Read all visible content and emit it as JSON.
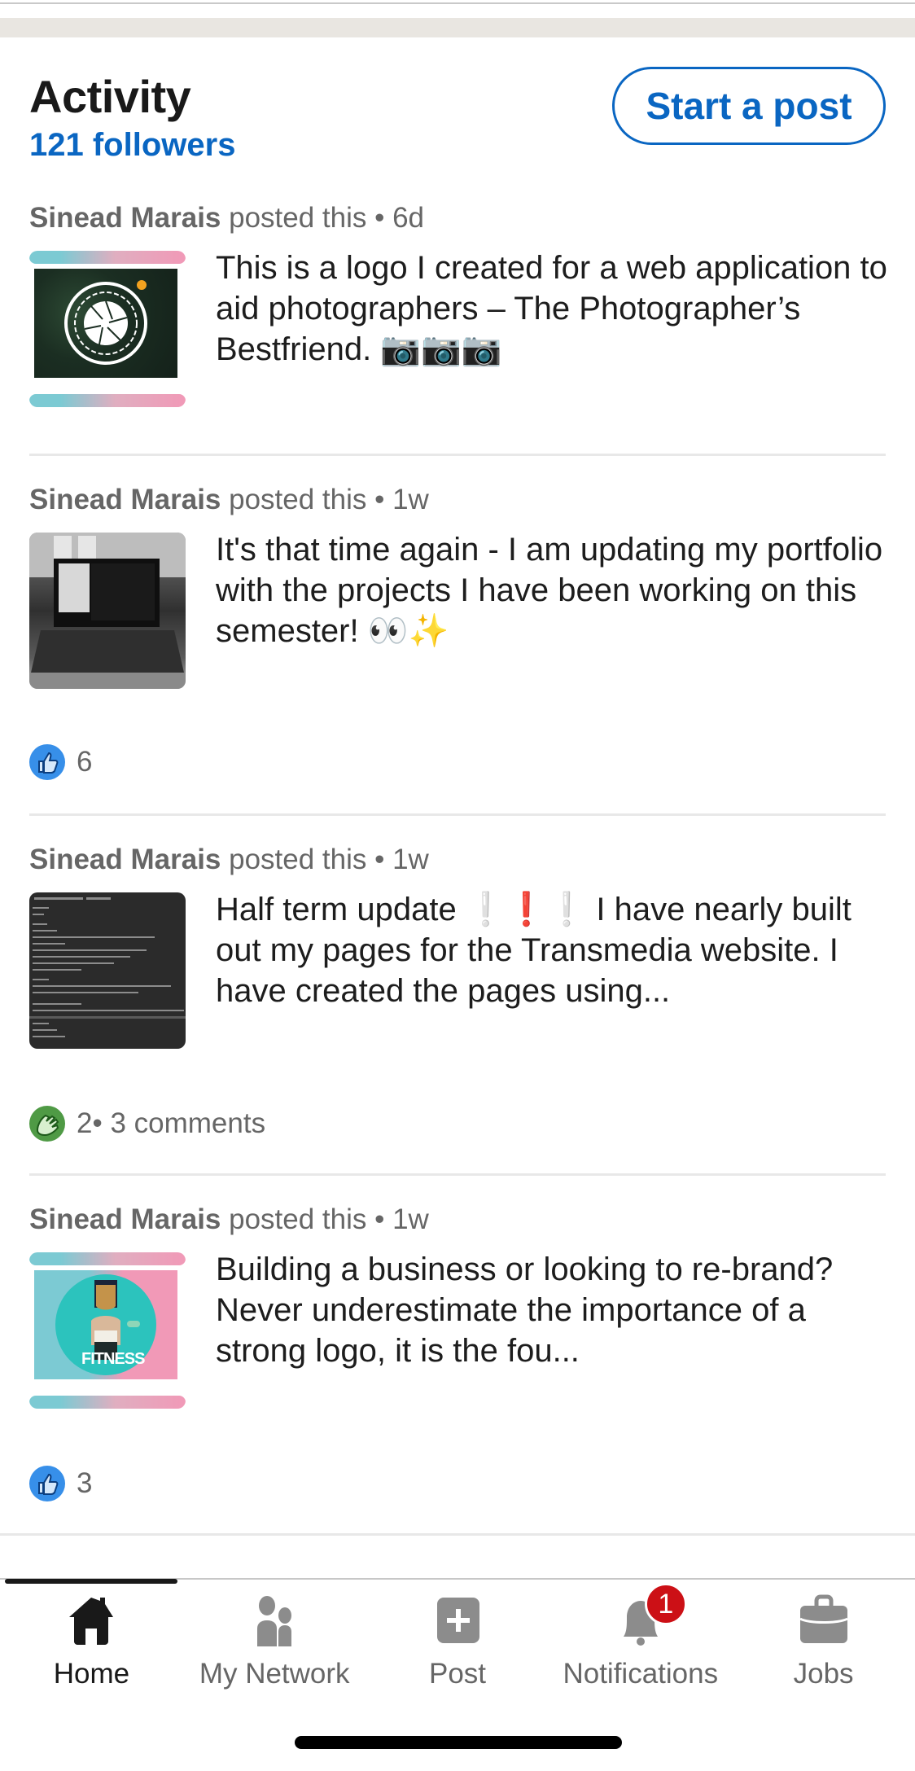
{
  "activity": {
    "title": "Activity",
    "followers": "121 followers",
    "start_post_label": "Start a post"
  },
  "posts": [
    {
      "author": "Sinead Marais",
      "action": " posted this",
      "separator": " • ",
      "age": "6d",
      "text": "This is a logo I created for a web application to aid photographers – The Photographer’s Bestfriend. 📷📷📷",
      "thumbnail": "photographer-logo-thumbnail",
      "reactions": null
    },
    {
      "author": "Sinead Marais",
      "action": " posted this",
      "separator": " • ",
      "age": "1w",
      "text": "It's that time again - I am updating my portfolio with the projects I have been working on this semester! 👀✨",
      "thumbnail": "laptop-photo-thumbnail",
      "reactions": {
        "icon": "like-icon",
        "count": "6",
        "comments": ""
      }
    },
    {
      "author": "Sinead Marais",
      "action": " posted this",
      "separator": " • ",
      "age": "1w",
      "text": "Half term update ❕❗❕ I have nearly built out my pages for the Transmedia website. I have created the pages using...",
      "thumbnail": "code-editor-thumbnail",
      "reactions": {
        "icon": "celebrate-icon",
        "count": "2",
        "comments": " • 3 comments"
      }
    },
    {
      "author": "Sinead Marais",
      "action": " posted this",
      "separator": " • ",
      "age": "1w",
      "text": "Building a business or looking to re-brand? Never underestimate the importance of a strong logo, it is the fou...",
      "thumbnail": "fitness-logo-thumbnail",
      "reactions": {
        "icon": "like-icon",
        "count": "3",
        "comments": ""
      }
    }
  ],
  "thumb_text": {
    "fitness": "FITNESS"
  },
  "bottom_nav": {
    "items": [
      {
        "label": "Home",
        "icon": "home-icon",
        "active": true
      },
      {
        "label": "My Network",
        "icon": "network-icon",
        "active": false
      },
      {
        "label": "Post",
        "icon": "post-plus-icon",
        "active": false
      },
      {
        "label": "Notifications",
        "icon": "bell-icon",
        "active": false,
        "badge": "1"
      },
      {
        "label": "Jobs",
        "icon": "briefcase-icon",
        "active": false
      }
    ]
  },
  "colors": {
    "accent": "#0a66c2",
    "badge": "#cc1016",
    "like": "#378fe9",
    "celebrate": "#4f9a45"
  }
}
